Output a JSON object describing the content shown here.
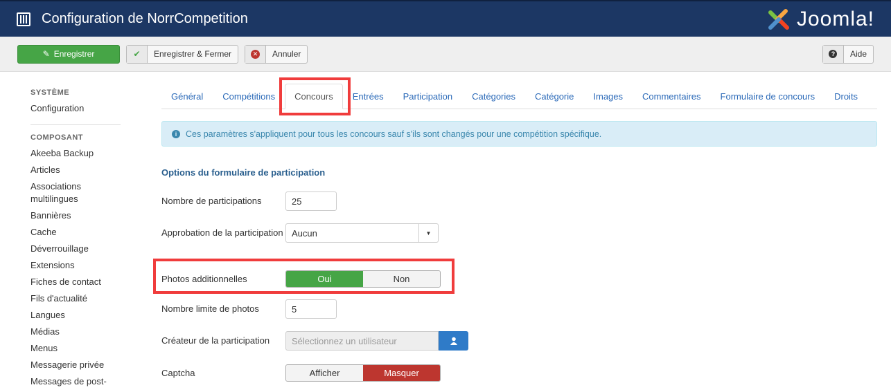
{
  "header": {
    "title": "Configuration de NorrCompetition",
    "logo_text": "Joomla!",
    "icon": "options-icon"
  },
  "toolbar": {
    "save": "Enregistrer",
    "save_close": "Enregistrer & Fermer",
    "cancel": "Annuler",
    "help": "Aide"
  },
  "sidebar": {
    "system_heading": "SYSTÈME",
    "system_items": [
      "Configuration"
    ],
    "component_heading": "COMPOSANT",
    "items": [
      "Akeeba Backup",
      "Articles",
      "Associations multilingues",
      "Bannières",
      "Cache",
      "Déverrouillage",
      "Extensions",
      "Fiches de contact",
      "Fils d'actualité",
      "Langues",
      "Médias",
      "Menus",
      "Messagerie privée",
      "Messages de post-"
    ]
  },
  "tabs": [
    "Général",
    "Compétitions",
    "Concours",
    "Entrées",
    "Participation",
    "Catégories",
    "Catégorie",
    "Images",
    "Commentaires",
    "Formulaire de concours",
    "Droits"
  ],
  "active_tab": "Concours",
  "alert": "Ces paramètres s'appliquent pour tous les concours sauf s'ils sont changés pour une compétition spécifique.",
  "form": {
    "legend": "Options du formulaire de participation",
    "nb_label": "Nombre de participations",
    "nb_value": "25",
    "approval_label": "Approbation de la participation",
    "approval_value": "Aucun",
    "photos_label": "Photos additionnelles",
    "photos_yes": "Oui",
    "photos_no": "Non",
    "photos_selected": "Oui",
    "limit_label": "Nombre limite de photos",
    "limit_value": "5",
    "creator_label": "Créateur de la participation",
    "creator_placeholder": "Sélectionnez un utilisateur",
    "captcha_label": "Captcha",
    "captcha_show": "Afficher",
    "captcha_hide": "Masquer",
    "captcha_selected": "Masquer"
  },
  "colors": {
    "header": "#1c3764",
    "success": "#46a546",
    "danger": "#bd362f",
    "highlight": "#f03c3c",
    "link": "#2a69b8"
  }
}
